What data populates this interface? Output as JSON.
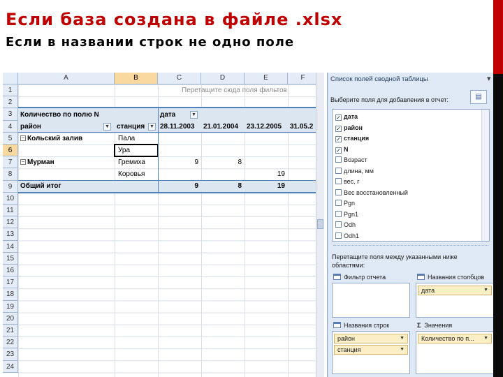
{
  "slide": {
    "title": "Если база создана в файле .xlsx",
    "subtitle": "Если в названии строк не одно поле"
  },
  "sheet": {
    "columns": [
      "A",
      "B",
      "C",
      "D",
      "E",
      "F"
    ],
    "selected_column": "B",
    "rows": [
      "1",
      "2",
      "3",
      "4",
      "5",
      "6",
      "7",
      "8",
      "9",
      "10",
      "11",
      "12",
      "13",
      "14",
      "15",
      "16",
      "17",
      "18",
      "19",
      "20",
      "21",
      "22",
      "23",
      "24"
    ],
    "selected_row": "6",
    "drop_hint": "Перетащите сюда поля фильтов",
    "pivot": {
      "value_header": "Количество по полю N",
      "col_field": "дата",
      "row_field_1": "район",
      "row_field_2": "станция",
      "dates": [
        "28.11.2003",
        "21.01.2004",
        "23.12.2005",
        "31.05.2"
      ],
      "groups": [
        {
          "name": "Кольский залив",
          "stations": [
            "Пала",
            "Ура"
          ]
        },
        {
          "name": "Мурман",
          "stations": [
            "Гремиха",
            "Коровья"
          ]
        }
      ],
      "values": {
        "r7c": "9",
        "r7d": "8",
        "r8e": "19",
        "total_c": "9",
        "total_d": "8",
        "total_e": "19"
      },
      "grand_total": "Общий итог"
    }
  },
  "panel": {
    "title": "Список полей сводной таблицы",
    "subtitle": "Выберите поля для добавления в отчет:",
    "fields": [
      {
        "label": "дата",
        "checked": true,
        "bold": true
      },
      {
        "label": "район",
        "checked": true,
        "bold": true
      },
      {
        "label": "станция",
        "checked": true,
        "bold": true
      },
      {
        "label": "N",
        "checked": true,
        "bold": true
      },
      {
        "label": "Возраст",
        "checked": false,
        "bold": false
      },
      {
        "label": "длина, мм",
        "checked": false,
        "bold": false
      },
      {
        "label": "вес, г",
        "checked": false,
        "bold": false
      },
      {
        "label": "Вес восстановленный",
        "checked": false,
        "bold": false
      },
      {
        "label": "Pgn",
        "checked": false,
        "bold": false
      },
      {
        "label": "Pgn1",
        "checked": false,
        "bold": false
      },
      {
        "label": "Odh",
        "checked": false,
        "bold": false
      },
      {
        "label": "Odh1",
        "checked": false,
        "bold": false
      }
    ],
    "drag_hint": "Перетащите поля между указанными ниже областями:",
    "areas": {
      "report_filter": "Фильтр отчета",
      "column_labels": "Названия столбцов",
      "row_labels": "Названия строк",
      "values": "Значения"
    },
    "column_chips": [
      "дата"
    ],
    "row_chips": [
      "район",
      "станция"
    ],
    "value_chips": [
      "Количество по п..."
    ]
  }
}
